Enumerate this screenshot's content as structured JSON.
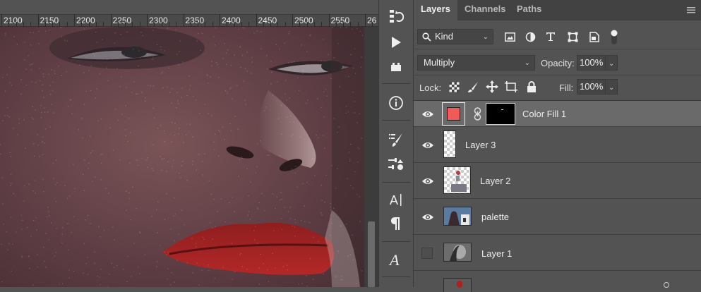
{
  "ruler": {
    "labels": [
      "2100",
      "2150",
      "2200",
      "2250",
      "2300",
      "2350",
      "2400",
      "2450",
      "2500",
      "2550",
      "26"
    ]
  },
  "tools": [
    {
      "name": "history-icon"
    },
    {
      "name": "play-icon"
    },
    {
      "name": "plugin-icon"
    },
    {
      "name": "info-icon"
    },
    {
      "name": "brush-settings-icon"
    },
    {
      "name": "adjustments-icon"
    },
    {
      "name": "character-icon"
    },
    {
      "name": "paragraph-icon"
    },
    {
      "name": "glyphs-icon"
    }
  ],
  "panel": {
    "tabs": [
      "Layers",
      "Channels",
      "Paths"
    ],
    "active_tab": "Layers",
    "filter": {
      "kind_label": "Kind"
    },
    "blend_mode": "Multiply",
    "opacity_label": "Opacity:",
    "opacity_value": "100%",
    "lock_label": "Lock:",
    "fill_label": "Fill:",
    "fill_value": "100%"
  },
  "layers": [
    {
      "name": "Color Fill 1",
      "visible": true,
      "selected": true,
      "fill_color": "#f05a5a",
      "type": "fill"
    },
    {
      "name": "Layer 3",
      "visible": true,
      "selected": false,
      "type": "transparent"
    },
    {
      "name": "Layer 2",
      "visible": true,
      "selected": false,
      "type": "pixel"
    },
    {
      "name": "palette",
      "visible": true,
      "selected": false,
      "type": "image"
    },
    {
      "name": "Layer 1",
      "visible": false,
      "selected": false,
      "type": "image-gray"
    },
    {
      "name": "",
      "visible": false,
      "selected": false,
      "type": "partial"
    }
  ],
  "colors": {
    "panel_bg": "#535353",
    "tab_bg": "#424242",
    "selected_layer": "#6a6a6a",
    "fill_swatch": "#f05a5a"
  }
}
